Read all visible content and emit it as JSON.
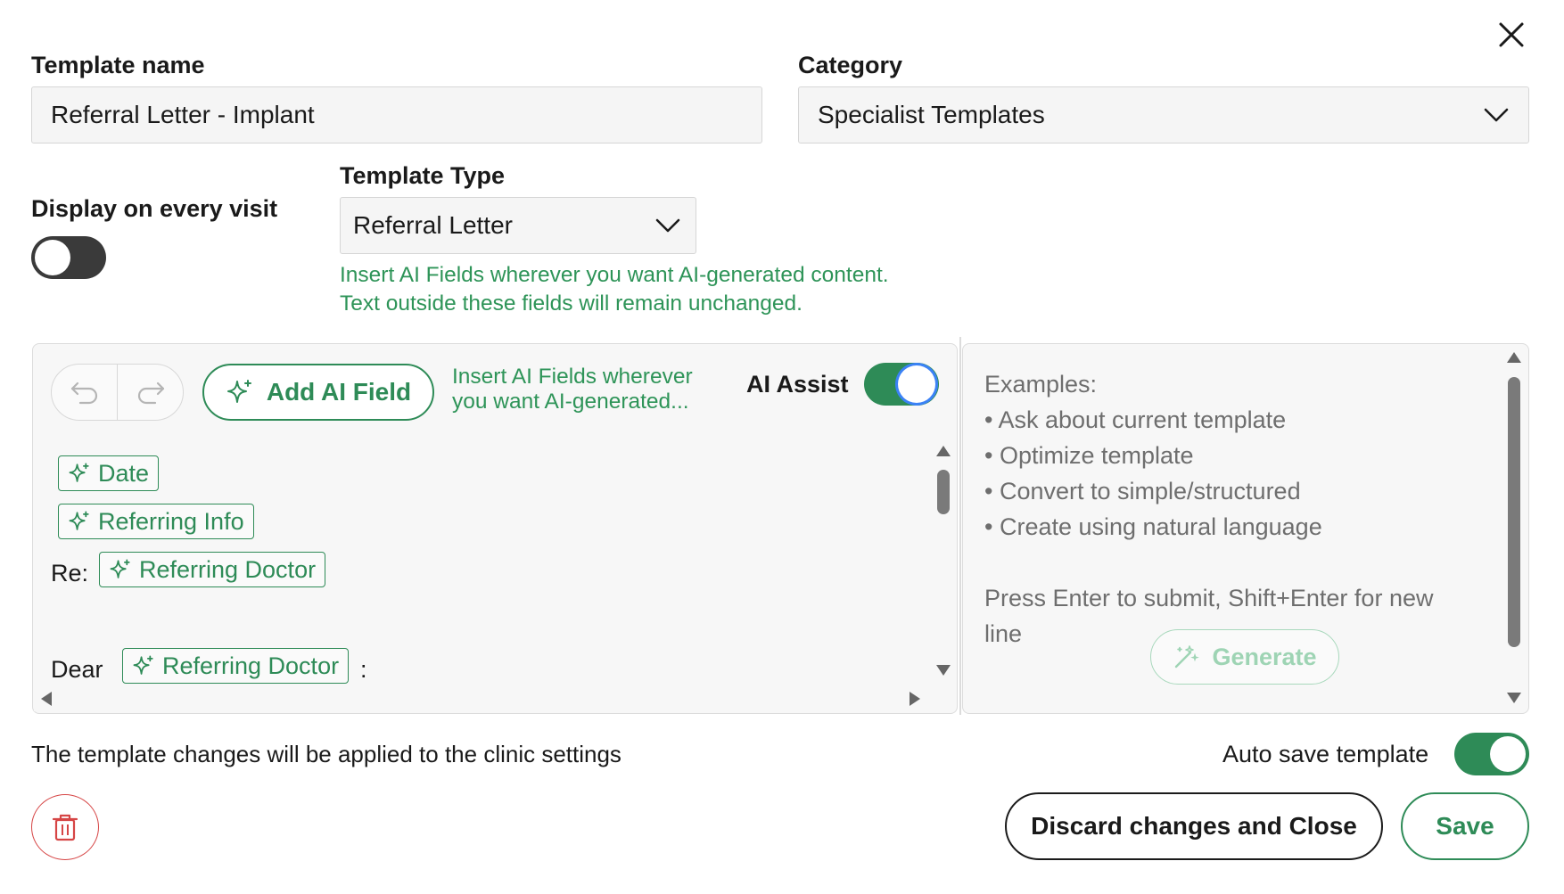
{
  "dialog": {
    "close_icon": "close-icon"
  },
  "template_name": {
    "label": "Template name",
    "value": "Referral Letter - Implant"
  },
  "category": {
    "label": "Category",
    "value": "Specialist Templates"
  },
  "display_every_visit": {
    "label": "Display on every visit",
    "enabled": false
  },
  "template_type": {
    "label": "Template Type",
    "value": "Referral Letter",
    "hint_line1": "Insert AI Fields wherever you want AI-generated content.",
    "hint_line2": "Text outside these fields will remain unchanged."
  },
  "editor": {
    "add_ai_field_label": "Add AI Field",
    "hint_line1": "Insert AI Fields wherever",
    "hint_line2": "you want AI-generated...",
    "ai_assist_label": "AI Assist",
    "ai_assist_enabled": true,
    "content": {
      "chip_date": "Date",
      "chip_referring_info": "Referring Info",
      "re_label": "Re:",
      "chip_referring_doctor_1": "Referring Doctor",
      "dear_label": "Dear",
      "chip_referring_doctor_2": "Referring Doctor",
      "colon": ":"
    }
  },
  "assist_panel": {
    "examples_title": "Examples:",
    "examples": [
      "• Ask about current template",
      "• Optimize template",
      "• Convert to simple/structured",
      "• Create using natural language"
    ],
    "instructions_line1": "Press Enter to submit, Shift+Enter for new",
    "instructions_line2": "line",
    "generate_label": "Generate"
  },
  "footer": {
    "note": "The template changes will be applied to the clinic settings",
    "auto_save_label": "Auto save template",
    "auto_save_enabled": true,
    "discard_label": "Discard changes and Close",
    "save_label": "Save"
  },
  "colors": {
    "accent": "#2e8b57",
    "danger": "#d64545"
  }
}
